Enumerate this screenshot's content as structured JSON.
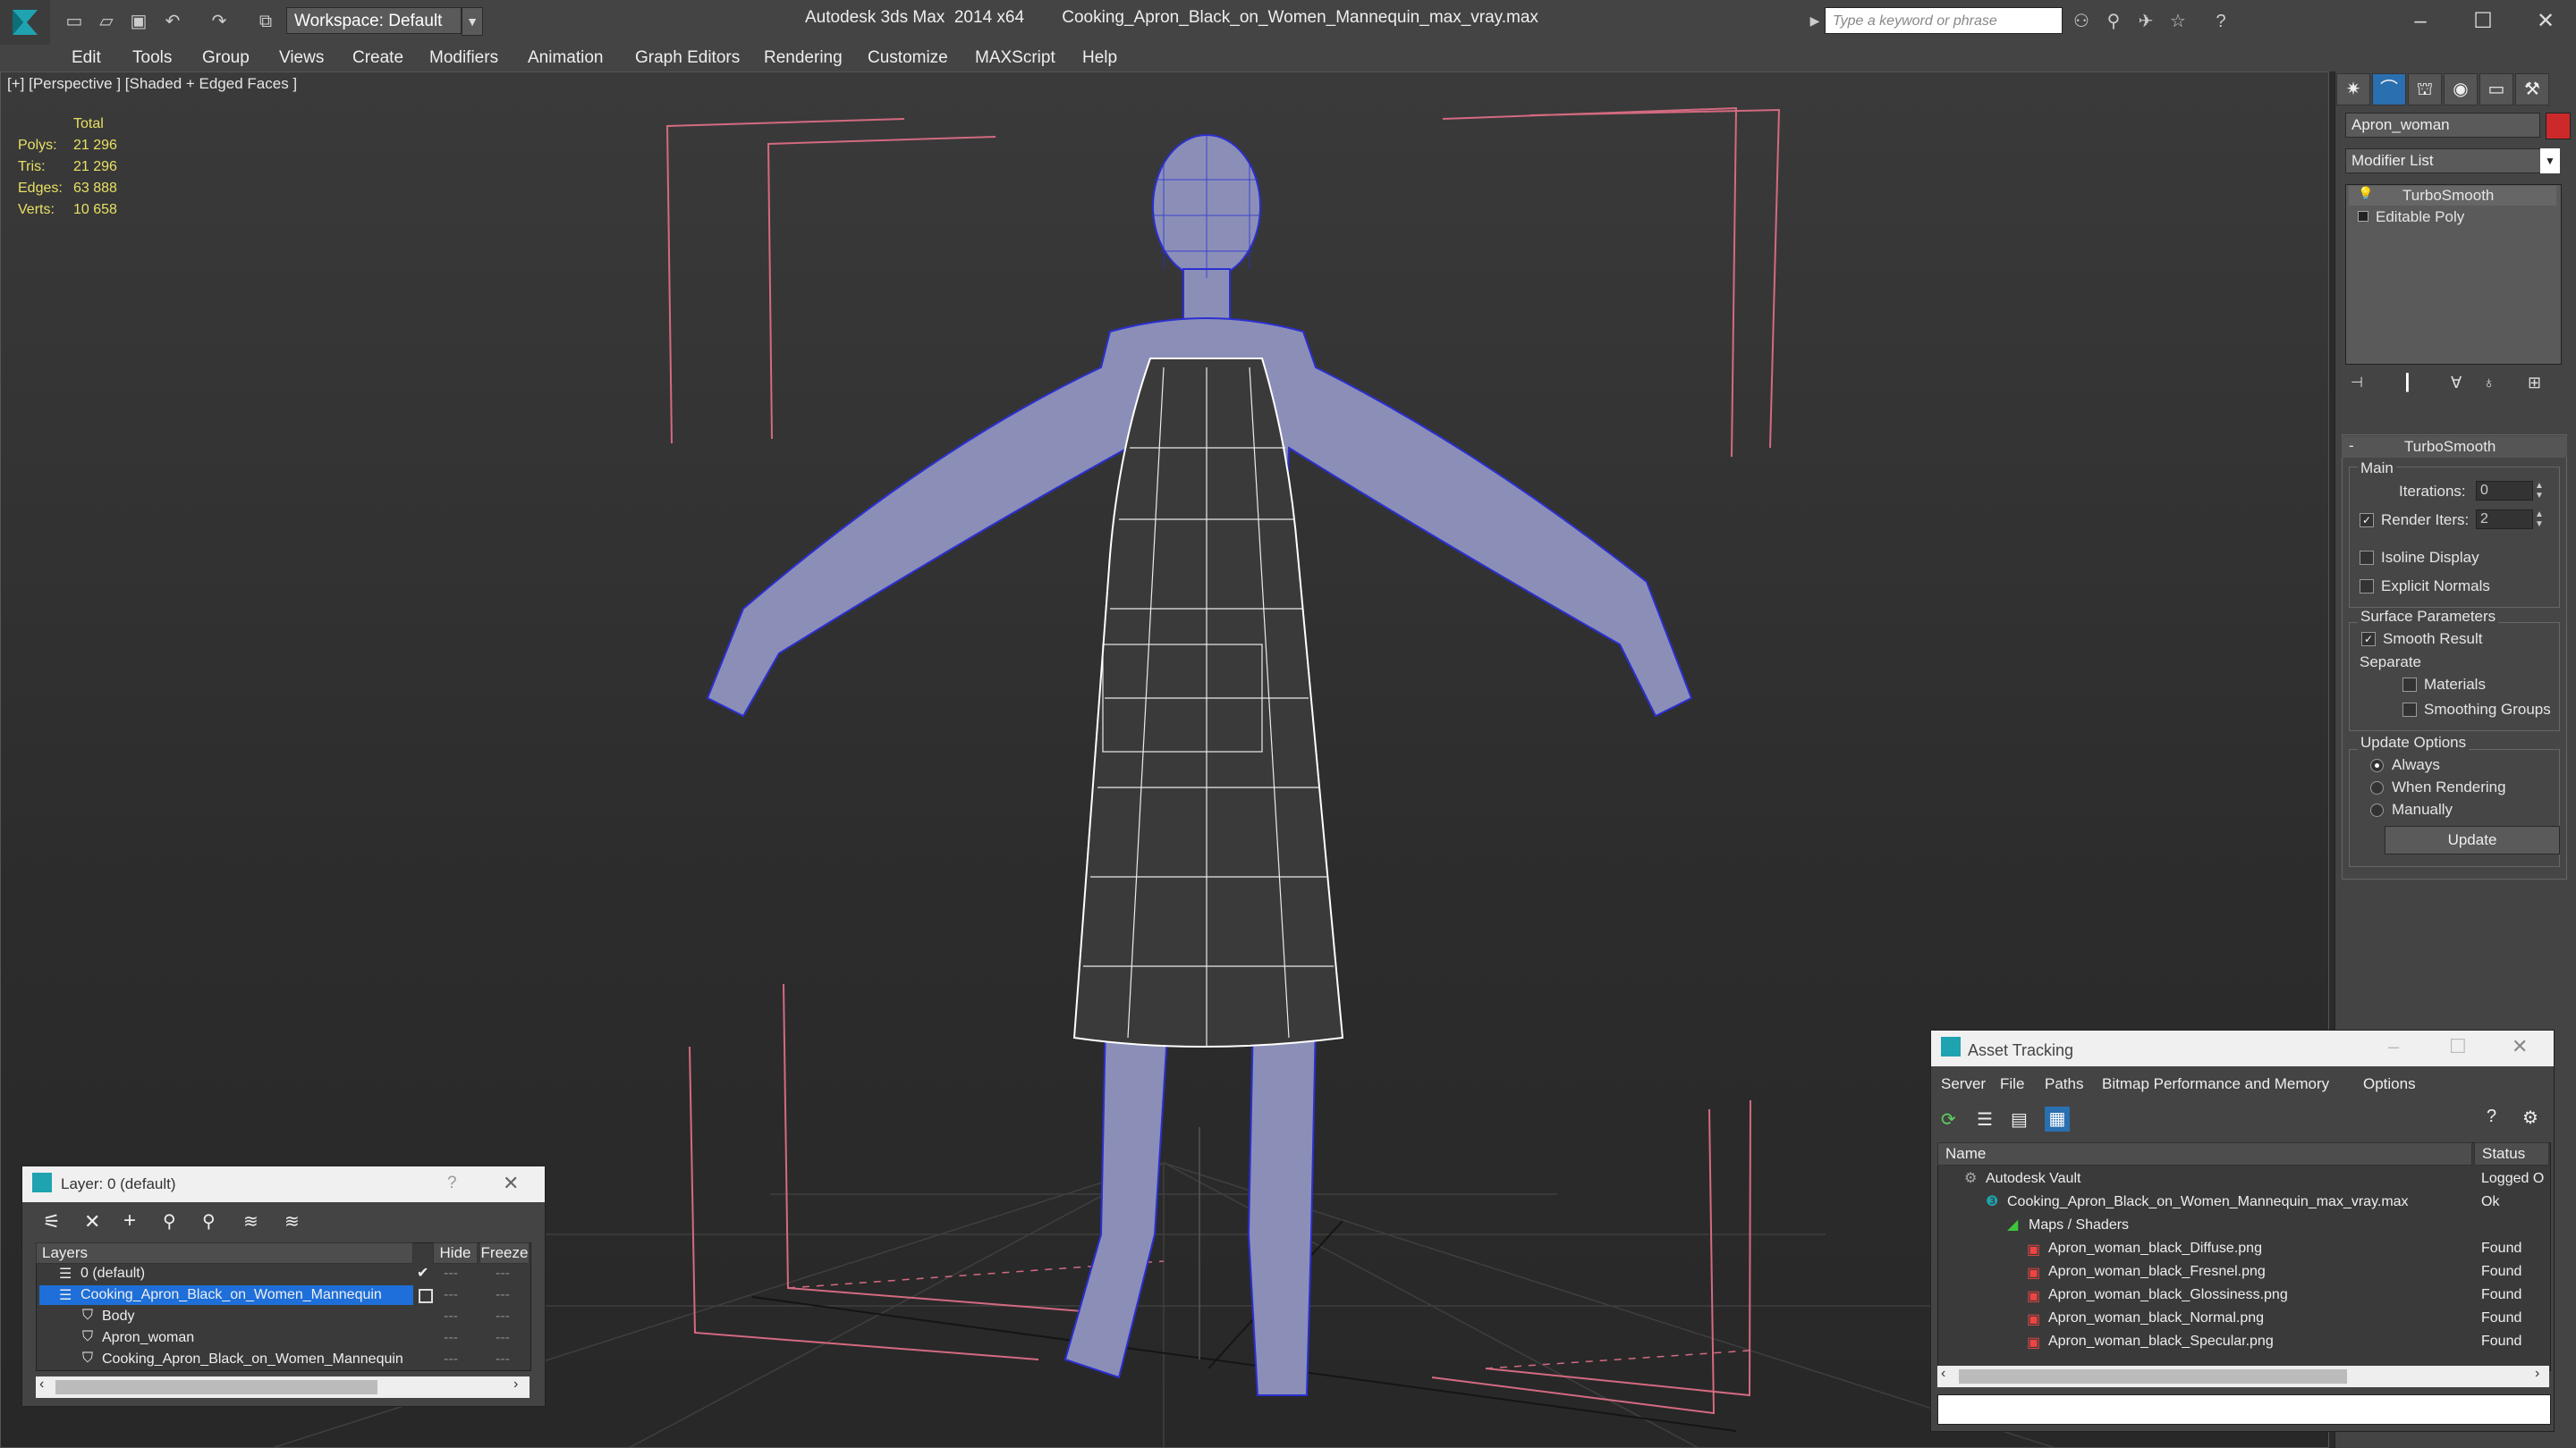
{
  "titlebar": {
    "app_title": "Autodesk 3ds Max  2014 x64        Cooking_Apron_Black_on_Women_Mannequin_max_vray.max",
    "workspace": "Workspace: Default",
    "search_placeholder": "Type a keyword or phrase"
  },
  "menu": [
    "Edit",
    "Tools",
    "Group",
    "Views",
    "Create",
    "Modifiers",
    "Animation",
    "Graph Editors",
    "Rendering",
    "Customize",
    "MAXScript",
    "Help"
  ],
  "viewport": {
    "label": "[+] [Perspective ] [Shaded + Edged Faces ]",
    "stats_header": "Total",
    "stats": [
      {
        "label": "Polys:",
        "value": "21 296"
      },
      {
        "label": "Tris:",
        "value": "21 296"
      },
      {
        "label": "Edges:",
        "value": "63 888"
      },
      {
        "label": "Verts:",
        "value": "10 658"
      }
    ]
  },
  "command_panel": {
    "object_name": "Apron_woman",
    "modifier_list": "Modifier List",
    "stack": [
      "TurboSmooth",
      "Editable Poly"
    ],
    "rollout_title": "TurboSmooth",
    "main_label": "Main",
    "iterations_label": "Iterations:",
    "iterations_value": "0",
    "render_iters_label": "Render Iters:",
    "render_iters_value": "2",
    "isoline": "Isoline Display",
    "explicit_normals": "Explicit Normals",
    "surface_params": "Surface Parameters",
    "smooth_result": "Smooth Result",
    "separate": "Separate",
    "materials": "Materials",
    "smoothing_groups": "Smoothing Groups",
    "update_options": "Update Options",
    "always": "Always",
    "when_rendering": "When Rendering",
    "manually": "Manually",
    "update_button": "Update"
  },
  "layer_window": {
    "title": "Layer: 0 (default)",
    "help": "?",
    "col_layers": "Layers",
    "col_hide": "Hide",
    "col_freeze": "Freeze",
    "rows": [
      {
        "name": "0 (default)",
        "indent": 0,
        "selected": false
      },
      {
        "name": "Cooking_Apron_Black_on_Women_Mannequin",
        "indent": 0,
        "selected": true
      },
      {
        "name": "Body",
        "indent": 1,
        "selected": false
      },
      {
        "name": "Apron_woman",
        "indent": 1,
        "selected": false
      },
      {
        "name": "Cooking_Apron_Black_on_Women_Mannequin",
        "indent": 1,
        "selected": false
      }
    ]
  },
  "asset_window": {
    "title": "Asset Tracking",
    "menu": [
      "Server",
      "File",
      "Paths",
      "Bitmap Performance and Memory",
      "Options"
    ],
    "col_name": "Name",
    "col_status": "Status",
    "rows": [
      {
        "name": "Autodesk Vault",
        "status": "Logged O",
        "indent": 0
      },
      {
        "name": "Cooking_Apron_Black_on_Women_Mannequin_max_vray.max",
        "status": "Ok",
        "indent": 1
      },
      {
        "name": "Maps / Shaders",
        "status": "",
        "indent": 2
      },
      {
        "name": "Apron_woman_black_Diffuse.png",
        "status": "Found",
        "indent": 3
      },
      {
        "name": "Apron_woman_black_Fresnel.png",
        "status": "Found",
        "indent": 3
      },
      {
        "name": "Apron_woman_black_Glossiness.png",
        "status": "Found",
        "indent": 3
      },
      {
        "name": "Apron_woman_black_Normal.png",
        "status": "Found",
        "indent": 3
      },
      {
        "name": "Apron_woman_black_Specular.png",
        "status": "Found",
        "indent": 3
      }
    ]
  }
}
